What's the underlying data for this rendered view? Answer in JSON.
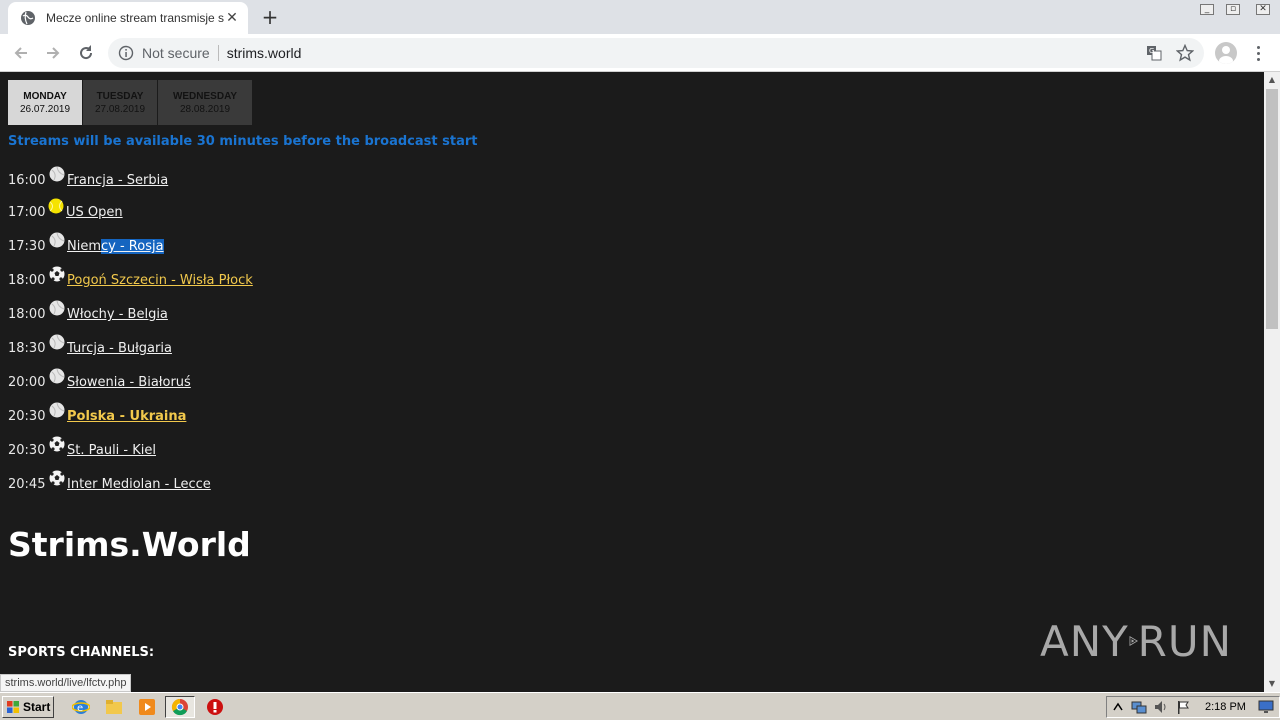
{
  "browser": {
    "tab_title": "Mecze online stream transmisje sport",
    "security_label": "Not secure",
    "url": "strims.world",
    "status_url": "strims.world/live/lfctv.php"
  },
  "days": [
    {
      "name": "MONDAY",
      "date": "26.07.2019",
      "active": true
    },
    {
      "name": "TUESDAY",
      "date": "27.08.2019",
      "active": false
    },
    {
      "name": "WEDNESDAY",
      "date": "28.08.2019",
      "active": false
    }
  ],
  "notice": "Streams will be available 30 minutes before the broadcast start",
  "matches": [
    {
      "time": "16:00",
      "icon": "volleyball-icon",
      "title": "Francja - Serbia"
    },
    {
      "time": "17:00",
      "icon": "tennis-ball-icon",
      "title": "US Open"
    },
    {
      "time": "17:30",
      "icon": "volleyball-icon",
      "title_pre": "Niem",
      "title_hl": "cy - Rosja"
    },
    {
      "time": "18:00",
      "icon": "soccer-ball-icon",
      "title": "Pogoń Szczecin - Wisła Płock"
    },
    {
      "time": "18:00",
      "icon": "volleyball-icon",
      "title": "Włochy - Belgia"
    },
    {
      "time": "18:30",
      "icon": "volleyball-icon",
      "title": "Turcja - Bułgaria"
    },
    {
      "time": "20:00",
      "icon": "volleyball-icon",
      "title": "Słowenia - Białoruś"
    },
    {
      "time": "20:30",
      "icon": "volleyball-icon",
      "title": "Polska - Ukraina"
    },
    {
      "time": "20:30",
      "icon": "soccer-ball-icon",
      "title": "St. Pauli - Kiel"
    },
    {
      "time": "20:45",
      "icon": "soccer-ball-icon",
      "title": "Inter Mediolan - Lecce"
    }
  ],
  "site_title": "Strims.World",
  "channels_heading": "SPORTS CHANNELS:",
  "watermark": {
    "left": "ANY",
    "right": "RUN"
  },
  "taskbar": {
    "start_label": "Start",
    "clock": "2:18 PM"
  },
  "colors": {
    "page_bg": "#1b1b1b",
    "notice": "#1a74d1",
    "gold_link": "#f2c94c",
    "selection": "#1565c0"
  }
}
